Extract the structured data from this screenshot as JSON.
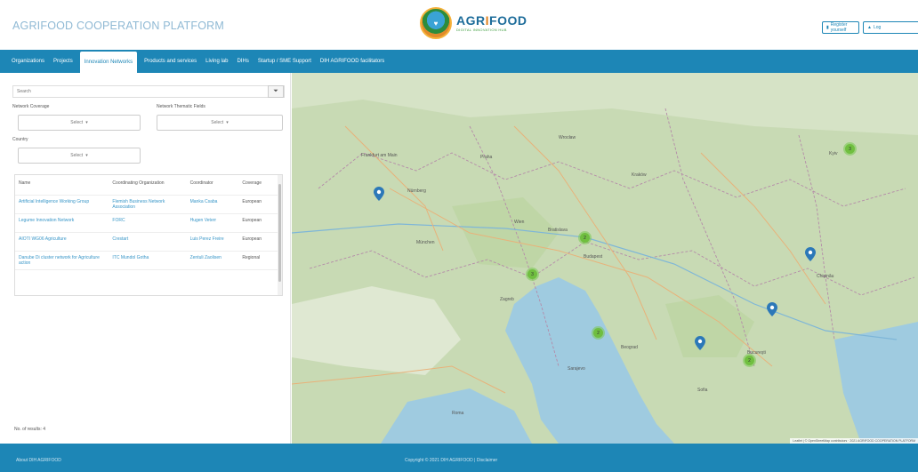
{
  "header": {
    "platform_title": "AGRIFOOD COOPERATION PLATFORM",
    "logo_main_a": "AGR",
    "logo_main_b": "I",
    "logo_main_c": "FOOD",
    "logo_sub": "DIGITAL INNOVATION HUB",
    "register_label": "Register yourself",
    "login_label": "Log"
  },
  "nav": {
    "items": [
      "Organizations",
      "Projects",
      "Innovation Networks",
      "Products and services",
      "Living lab",
      "DIHs",
      "Startup / SME Support",
      "DIH AGRIFOOD facilitators"
    ],
    "active_index": 2
  },
  "filters": {
    "search_placeholder": "Search",
    "network_coverage_label": "Network Coverage",
    "network_thematic_label": "Network Thematic Fields",
    "country_label": "Country",
    "select_label": "Select"
  },
  "table": {
    "headers": [
      "Name",
      "Coordinating Organization",
      "Coordinator",
      "Coverage"
    ],
    "rows": [
      [
        "Artificial Intelligence Working Group",
        "Flemish Business Network Association",
        "Manka Csaba",
        "European"
      ],
      [
        "Legume Innovation Network",
        "FORC",
        "Hugen Veterr",
        "European"
      ],
      [
        "AIOTI WG06 Agriculture",
        "Crestart",
        "Luis Perez Freire",
        "European"
      ],
      [
        "Danube Di cluster network for Agriculture action",
        "ITC Mundol Gotha",
        "Zentuli Zaolisen",
        "Regional"
      ]
    ]
  },
  "results_label": "No. of results: 4",
  "map": {
    "cluster_counts": [
      "3",
      "2",
      "3",
      "2",
      "2"
    ],
    "attribution": "Leaflet | © OpenStreetMap contributors · 2021 AGRIFOOD COOPERATION PLATFORM",
    "place_labels": [
      "Frankfurt am Main",
      "Nürnberg",
      "Praha",
      "Wrocław",
      "Kraków",
      "München",
      "Wien",
      "Bratislava",
      "Budapest",
      "Zagreb",
      "Beograd",
      "Bucureşti",
      "Sofia",
      "Kyiv",
      "Chişinău",
      "Sarajevo",
      "Roma"
    ]
  },
  "footer": {
    "about": "About DIH AGRIFOOD",
    "copyright": "Copyright © 2021 DIH AGRIFOOD | Disclaimer"
  },
  "colors": {
    "brand_blue": "#1d86b6",
    "link_blue": "#3896c8",
    "cluster_green": "#6ebe3c",
    "marker_blue": "#2c78b8"
  }
}
